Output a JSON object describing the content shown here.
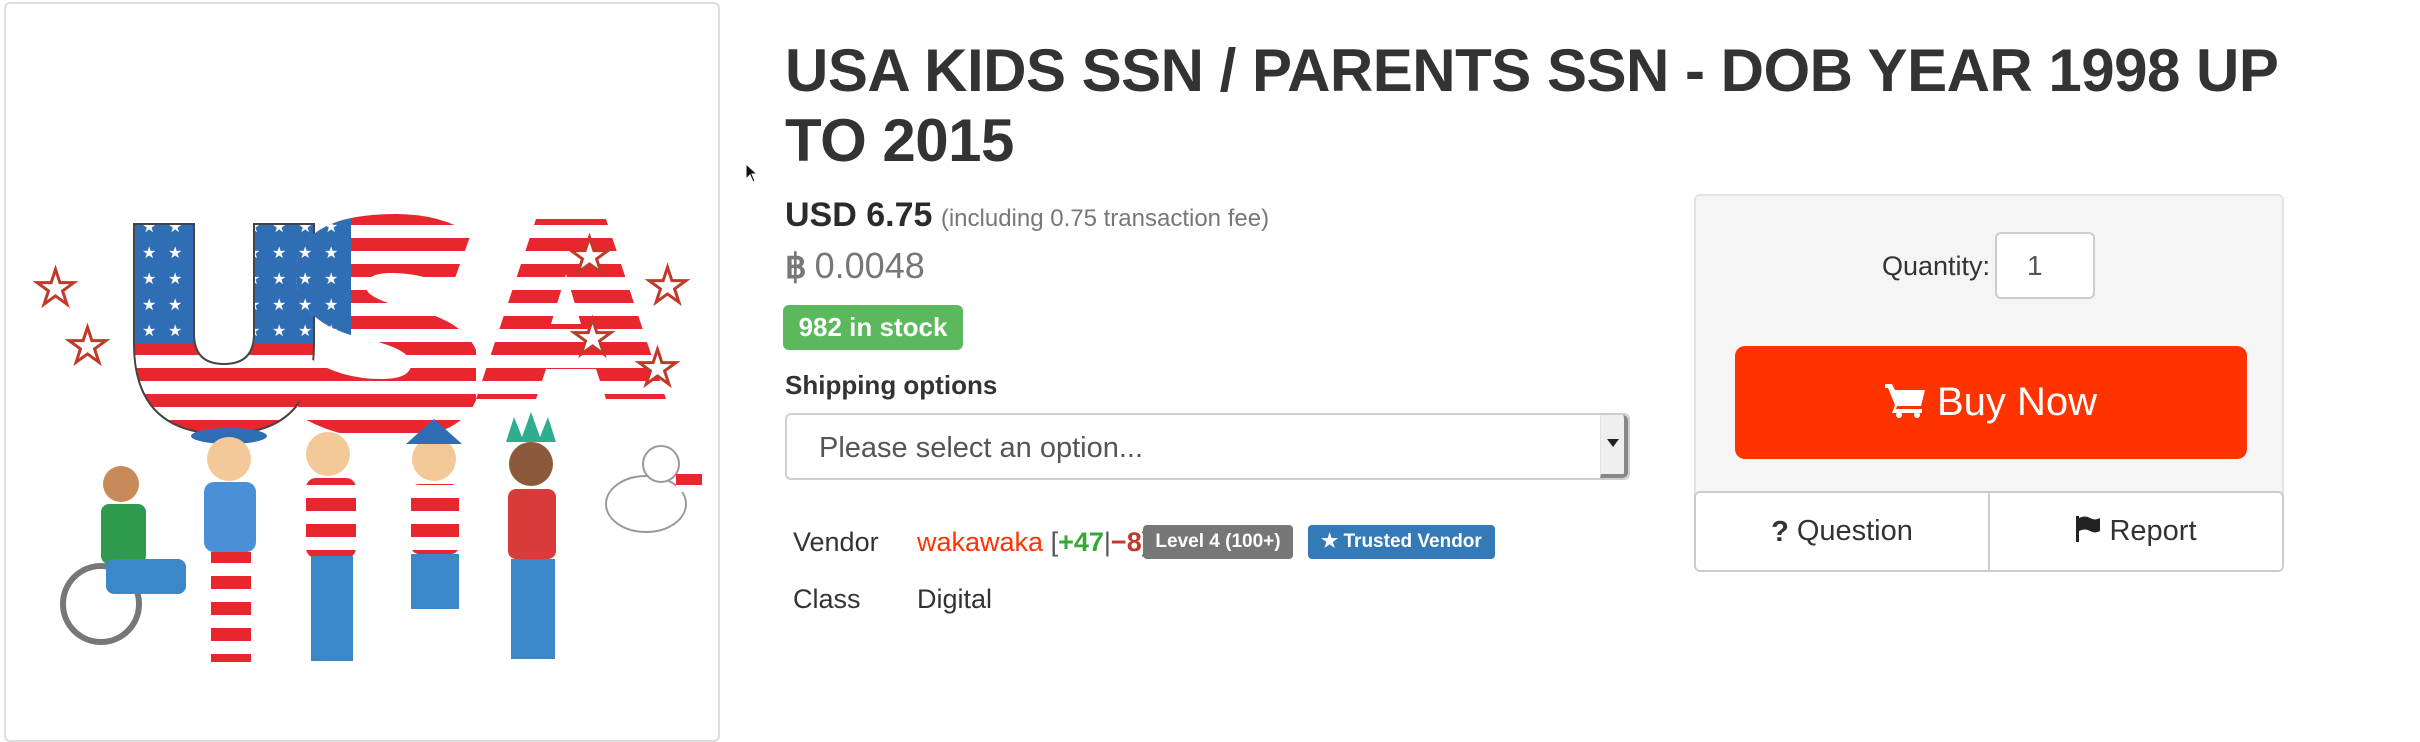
{
  "product": {
    "title": "USA KIDS SSN / PARENTS SSN - DOB YEAR 1998 UP TO 2015",
    "image_alt": "USA kids illustration",
    "image_text": "USA"
  },
  "price": {
    "usd": "USD 6.75",
    "fee_note": "(including 0.75 transaction fee)",
    "btc_icon": "bitcoin-icon",
    "btc_symbol": "฿",
    "btc": "0.0048"
  },
  "stock": {
    "label": "982 in stock",
    "count": 982,
    "color": "#5cb85c"
  },
  "shipping": {
    "label": "Shipping options",
    "placeholder": "Please select an option..."
  },
  "details": {
    "vendor_label": "Vendor",
    "vendor_name": "wakawaka",
    "feedback_open": "[",
    "feedback_positive": "+47",
    "feedback_separator": "|",
    "feedback_negative": "−8",
    "feedback_close": "]",
    "level_badge": "Level 4 (100+)",
    "trusted_badge": "Trusted Vendor",
    "class_label": "Class",
    "class_value": "Digital"
  },
  "purchase": {
    "quantity_label": "Quantity:",
    "quantity_value": "1",
    "buy_label": "Buy Now",
    "buy_color": "#ff3300"
  },
  "actions": {
    "question_icon": "?",
    "question_label": "Question",
    "report_label": "Report"
  },
  "colors": {
    "vendor_name": "#ff3300",
    "feedback_positive": "#33aa33",
    "feedback_negative": "#c0392b",
    "level_badge": "#777777",
    "trusted_badge": "#337ab7"
  }
}
